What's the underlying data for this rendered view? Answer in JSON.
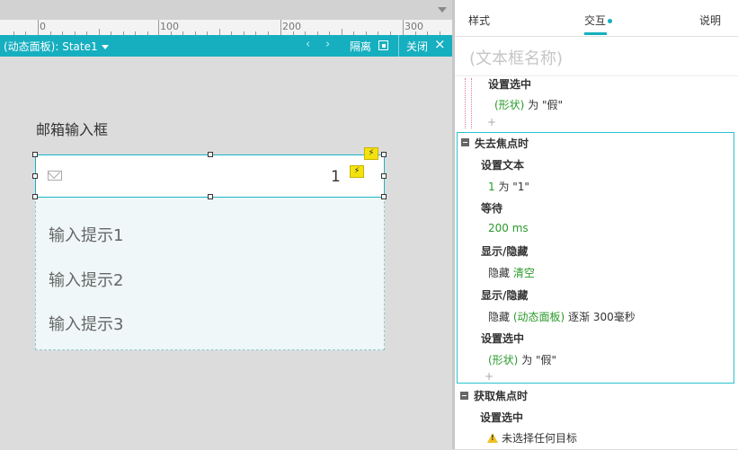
{
  "ruler": {
    "labels": [
      "0",
      "100",
      "200",
      "300"
    ]
  },
  "dynamic_panel_bar": {
    "title": "(动态面板): State1",
    "isolate_label": "隔离",
    "close_label": "关闭"
  },
  "canvas": {
    "field_label": "邮箱输入框",
    "input_value": "1",
    "hints": [
      "输入提示1",
      "输入提示2",
      "输入提示3"
    ]
  },
  "panel": {
    "tabs": [
      {
        "label": "样式"
      },
      {
        "label": "交互"
      },
      {
        "label": "说明"
      }
    ],
    "active_tab": "交互",
    "name_placeholder": "(文本框名称)",
    "partial_event": {
      "action": "设置选中",
      "detail_target": "(形状)",
      "detail_rest": " 为 \"假\""
    },
    "blur_event": {
      "title": "失去焦点时",
      "actions": [
        {
          "name": "设置文本",
          "target": "1",
          "rest": " 为 \"1\""
        },
        {
          "name": "等待",
          "target": "200 ms",
          "rest": ""
        },
        {
          "name": "显示/隐藏",
          "prefix": "隐藏 ",
          "target": "清空",
          "rest": ""
        },
        {
          "name": "显示/隐藏",
          "prefix": "隐藏 ",
          "target": "(动态面板)",
          "rest": " 逐渐 300毫秒"
        },
        {
          "name": "设置选中",
          "target": "(形状)",
          "rest": " 为 \"假\""
        }
      ]
    },
    "focus_event": {
      "title": "获取焦点时",
      "action": "设置选中",
      "warning": "未选择任何目标"
    },
    "add_symbol": "+"
  }
}
